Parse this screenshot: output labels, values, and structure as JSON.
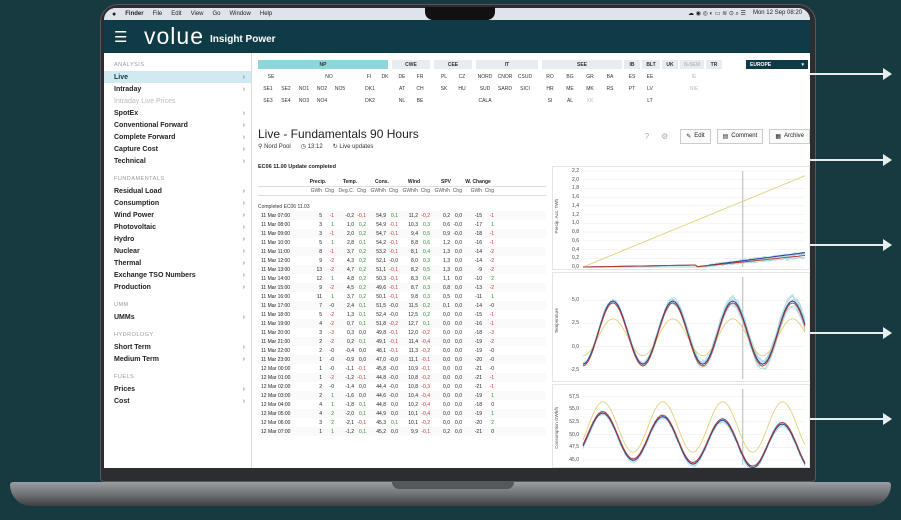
{
  "menubar": {
    "apple": "",
    "items": [
      "Finder",
      "File",
      "Edit",
      "View",
      "Go",
      "Window",
      "Help"
    ],
    "clock": "Mon 12 Sep 08:20"
  },
  "app": {
    "brand": "volue",
    "product": "Insight Power"
  },
  "sidebar": {
    "sections": [
      {
        "title": "ANALYSIS",
        "items": [
          {
            "label": "Live",
            "active": true,
            "chevron": true
          },
          {
            "label": "Intraday",
            "chevron": true
          },
          {
            "label": "Intraday Live Prices",
            "muted": true
          },
          {
            "label": "SpotEx",
            "chevron": true
          },
          {
            "label": "Conventional Forward",
            "chevron": true
          },
          {
            "label": "Complete Forward",
            "chevron": true
          },
          {
            "label": "Capture Cost",
            "chevron": true
          },
          {
            "label": "Technical",
            "chevron": true
          }
        ]
      },
      {
        "title": "FUNDAMENTALS",
        "items": [
          {
            "label": "Residual Load",
            "chevron": true
          },
          {
            "label": "Consumption",
            "chevron": true
          },
          {
            "label": "Wind Power",
            "chevron": true
          },
          {
            "label": "Photovoltaic",
            "chevron": true
          },
          {
            "label": "Hydro",
            "chevron": true
          },
          {
            "label": "Nuclear",
            "chevron": true
          },
          {
            "label": "Thermal",
            "chevron": true
          },
          {
            "label": "Exchange TSO Numbers",
            "chevron": true
          },
          {
            "label": "Production",
            "chevron": true
          }
        ]
      },
      {
        "title": "UMM",
        "items": [
          {
            "label": "UMMs",
            "chevron": true
          }
        ]
      },
      {
        "title": "HYDROLOGY",
        "items": [
          {
            "label": "Short Term",
            "chevron": true
          },
          {
            "label": "Medium Term",
            "chevron": true
          }
        ]
      },
      {
        "title": "FUELS",
        "items": [
          {
            "label": "Prices",
            "chevron": true
          },
          {
            "label": "Cost",
            "chevron": true
          }
        ]
      }
    ]
  },
  "regions": {
    "headers": [
      "NP",
      "CWE",
      "CEE",
      "IT",
      "SEE",
      "IB",
      "BLT",
      "UK",
      "N-SEM",
      "TR",
      "EUROPE"
    ],
    "np_row1": [
      "SE",
      "NO",
      "FI",
      "DK"
    ],
    "np_row2": [
      "SE1",
      "SE2",
      "NO1",
      "NO2",
      "NO5",
      "DK1"
    ],
    "np_row3": [
      "SE3",
      "SE4",
      "NO3",
      "NO4",
      "DK2"
    ],
    "cwe": [
      "DE",
      "FR",
      "AT",
      "CH",
      "NL",
      "BE"
    ],
    "cee": [
      "PL",
      "CZ",
      "SK",
      "HU"
    ],
    "it": [
      "NORD",
      "CNOR",
      "CSUD",
      "SUD",
      "SARD",
      "SICI",
      "CALA"
    ],
    "see": [
      "RO",
      "BG",
      "GR",
      "BA",
      "HR",
      "ME",
      "MK",
      "RS",
      "SI",
      "AL",
      "XK"
    ],
    "ib": [
      "ES",
      "PT"
    ],
    "blt": [
      "EE",
      "LV",
      "LT"
    ],
    "nsem": [
      "IE",
      "NIE"
    ]
  },
  "page": {
    "title": "Live - Fundamentals 90 Hours",
    "location": "Nord Pool",
    "time": "13:12",
    "live": "Live updates",
    "update": "EC06 11.00 Update completed",
    "edit": "Edit",
    "comment": "Comment",
    "archive": "Archive"
  },
  "table": {
    "groups": [
      "Precip.",
      "Temp.",
      "Cons.",
      "Wind",
      "SPV",
      "W. Change"
    ],
    "units": [
      "GWh",
      "Chg",
      "Deg.C.",
      "Chg",
      "GWh/h",
      "Chg",
      "GWh/h",
      "Chg",
      "GWh/h",
      "Chg",
      "GWh",
      "Chg"
    ],
    "group_label": "Completed EC06 11.03",
    "rows": [
      [
        "11 Mar 07:00",
        "5",
        "-1",
        "-0,2",
        "-0,1",
        "54,9",
        "0,1",
        "11,2",
        "-0,2",
        "0,2",
        "0,0",
        "-15",
        "-1"
      ],
      [
        "11 Mar 08:00",
        "3",
        "1",
        "1,0",
        "0,2",
        "54,9",
        "-0,1",
        "10,3",
        "0,3",
        "0,6",
        "-0,0",
        "-17",
        "1"
      ],
      [
        "11 Mar 09:00",
        "3",
        "-1",
        "2,0",
        "0,2",
        "54,7",
        "-0,1",
        "9,4",
        "0,5",
        "0,9",
        "-0,0",
        "-18",
        "-1"
      ],
      [
        "11 Mar 10:00",
        "5",
        "1",
        "2,8",
        "0,1",
        "54,2",
        "-0,1",
        "8,8",
        "0,6",
        "1,2",
        "0,0",
        "-16",
        "-1"
      ],
      [
        "11 Mar 11:00",
        "8",
        "-1",
        "3,7",
        "0,2",
        "53,2",
        "-0,1",
        "8,1",
        "0,4",
        "1,3",
        "0,0",
        "-14",
        "-2"
      ],
      [
        "11 Mar 12:00",
        "9",
        "-2",
        "4,3",
        "0,2",
        "52,1",
        "-0,0",
        "8,0",
        "0,3",
        "1,3",
        "0,0",
        "-14",
        "-2"
      ],
      [
        "11 Mar 13:00",
        "13",
        "-2",
        "4,7",
        "0,2",
        "51,1",
        "-0,1",
        "8,2",
        "0,5",
        "1,3",
        "0,0",
        "-9",
        "-2"
      ],
      [
        "11 Mar 14:00",
        "12",
        "1",
        "4,8",
        "0,2",
        "50,3",
        "-0,1",
        "8,3",
        "0,4",
        "1,1",
        "0,0",
        "-10",
        "2"
      ],
      [
        "11 Mar 15:00",
        "9",
        "-2",
        "4,5",
        "0,2",
        "49,6",
        "-0,1",
        "8,7",
        "0,3",
        "0,8",
        "0,0",
        "-13",
        "-2"
      ],
      [
        "11 Mar 16:00",
        "11",
        "1",
        "3,7",
        "0,2",
        "50,1",
        "-0,1",
        "9,8",
        "0,3",
        "0,5",
        "0,0",
        "-11",
        "1"
      ],
      [
        "11 Mar 17:00",
        "7",
        "-0",
        "2,4",
        "0,1",
        "51,5",
        "-0,0",
        "11,5",
        "0,2",
        "0,1",
        "0,0",
        "-14",
        "-0"
      ],
      [
        "11 Mar 18:00",
        "5",
        "-2",
        "1,3",
        "0,1",
        "52,4",
        "-0,0",
        "12,5",
        "0,2",
        "0,0",
        "0,0",
        "-15",
        "-1"
      ],
      [
        "11 Mar 19:00",
        "4",
        "-2",
        "0,7",
        "0,1",
        "51,8",
        "-0,2",
        "12,7",
        "0,1",
        "0,0",
        "0,0",
        "-16",
        "-1"
      ],
      [
        "11 Mar 20:00",
        "3",
        "-3",
        "0,3",
        "0,0",
        "49,8",
        "-0,1",
        "12,0",
        "-0,2",
        "0,0",
        "0,0",
        "-18",
        "-3"
      ],
      [
        "11 Mar 21:00",
        "2",
        "-2",
        "0,2",
        "0,1",
        "49,1",
        "-0,1",
        "11,4",
        "-0,4",
        "0,0",
        "0,0",
        "-19",
        "-2"
      ],
      [
        "11 Mar 22:00",
        "2",
        "-0",
        "-0,4",
        "0,0",
        "48,1",
        "-0,1",
        "11,3",
        "-0,2",
        "0,0",
        "0,0",
        "-19",
        "-0"
      ],
      [
        "11 Mar 23:00",
        "1",
        "-0",
        "-0,9",
        "0,0",
        "47,0",
        "-0,0",
        "11,1",
        "-0,1",
        "0,0",
        "0,0",
        "-20",
        "-0"
      ],
      [
        "12 Mar 00:00",
        "1",
        "-0",
        "-1,1",
        "-0,1",
        "45,8",
        "-0,0",
        "10,9",
        "-0,1",
        "0,0",
        "0,0",
        "-21",
        "-0"
      ],
      [
        "12 Mar 01:00",
        "1",
        "-2",
        "-1,2",
        "-0,1",
        "44,8",
        "-0,0",
        "10,8",
        "-0,2",
        "0,0",
        "0,0",
        "-21",
        "-1"
      ],
      [
        "12 Mar 02:00",
        "2",
        "-0",
        "-1,4",
        "0,0",
        "44,4",
        "-0,0",
        "10,8",
        "-0,3",
        "0,0",
        "0,0",
        "-21",
        "-1"
      ],
      [
        "12 Mar 03:00",
        "2",
        "1",
        "-1,6",
        "0,0",
        "44,6",
        "-0,0",
        "10,4",
        "-0,4",
        "0,0",
        "0,0",
        "-19",
        "1"
      ],
      [
        "12 Mar 04:00",
        "4",
        "1",
        "-1,8",
        "0,1",
        "44,8",
        "0,0",
        "10,2",
        "-0,4",
        "0,0",
        "0,0",
        "-18",
        "0"
      ],
      [
        "12 Mar 05:00",
        "4",
        "2",
        "-2,0",
        "0,1",
        "44,9",
        "0,0",
        "10,1",
        "-0,4",
        "0,0",
        "0,0",
        "-19",
        "1"
      ],
      [
        "12 Mar 06:00",
        "3",
        "2",
        "-2,1",
        "-0,1",
        "45,3",
        "0,1",
        "10,1",
        "-0,2",
        "0,0",
        "0,0",
        "-20",
        "2"
      ],
      [
        "12 Mar 07:00",
        "1",
        "1",
        "-1,2",
        "0,1",
        "45,2",
        "0,0",
        "9,9",
        "-0,1",
        "0,2",
        "0,0",
        "-21",
        "0"
      ]
    ]
  },
  "charts": {
    "precip": {
      "ylabel": "Precip. Acc. TWh",
      "ticks": [
        "2,2",
        "2,0",
        "1,8",
        "1,6",
        "1,4",
        "1,2",
        "1,0",
        "0,8",
        "0,6",
        "0,4",
        "0,2",
        "0,0"
      ],
      "ylim": [
        0,
        2.2
      ]
    },
    "temp": {
      "ylabel": "Temperature",
      "ticks": [
        "5,0",
        "2,5",
        "0,0",
        "-2,5"
      ],
      "ylim": [
        -3.5,
        7.5
      ]
    },
    "cons": {
      "ylabel": "Consumption GWh/h",
      "ticks": [
        "57,5",
        "55,0",
        "52,5",
        "50,0",
        "47,5",
        "45,0"
      ],
      "ylim": [
        44,
        59
      ]
    },
    "colors": {
      "ens": "#9fd6dc",
      "mean": "#2b3f9a",
      "red": "#c0392b",
      "yellow": "#e0d27a"
    }
  }
}
